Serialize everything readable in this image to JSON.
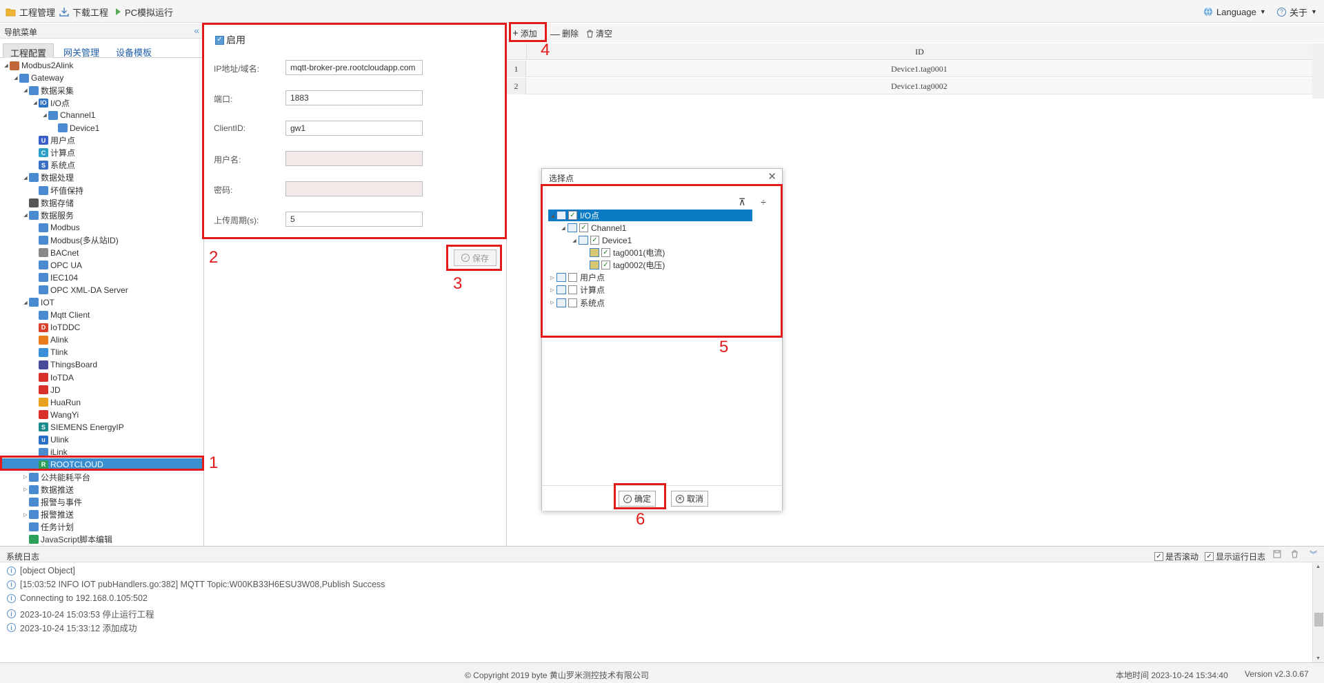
{
  "topbar": {
    "project_manage": "工程管理",
    "download_project": "下载工程",
    "pc_simulate": "PC模拟运行",
    "language": "Language",
    "about": "关于"
  },
  "nav": {
    "title": "导航菜单",
    "tabs": [
      "工程配置",
      "网关管理",
      "设备模板"
    ],
    "tree": [
      {
        "label": "Modbus2Alink",
        "indent": 0,
        "arrow": "◢",
        "icon": "stack-icon",
        "color": "#c0673a"
      },
      {
        "label": "Gateway",
        "indent": 1,
        "arrow": "◢",
        "icon": "gateway-icon",
        "color": "#4a8ad0"
      },
      {
        "label": "数据采集",
        "indent": 2,
        "arrow": "◢",
        "icon": "chart-icon",
        "color": "#4a8ad0"
      },
      {
        "label": "I/O点",
        "indent": 3,
        "arrow": "◢",
        "icon": "io-icon",
        "color": "#2f73c6"
      },
      {
        "label": "Channel1",
        "indent": 4,
        "arrow": "◢",
        "icon": "network-icon",
        "color": "#4a8ad0"
      },
      {
        "label": "Device1",
        "indent": 5,
        "arrow": "",
        "icon": "device-icon",
        "color": "#4a8ad0"
      },
      {
        "label": "用户点",
        "indent": 3,
        "arrow": "",
        "icon": "user-point-icon",
        "color": "#3b5fc9"
      },
      {
        "label": "计算点",
        "indent": 3,
        "arrow": "",
        "icon": "calc-point-icon",
        "color": "#2aa0c6"
      },
      {
        "label": "系统点",
        "indent": 3,
        "arrow": "",
        "icon": "system-point-icon",
        "color": "#3a6fc8"
      },
      {
        "label": "数据处理",
        "indent": 2,
        "arrow": "◢",
        "icon": "chart-line-icon",
        "color": "#4a8ad0"
      },
      {
        "label": "坏值保持",
        "indent": 3,
        "arrow": "",
        "icon": "wave-icon",
        "color": "#4a8ad0"
      },
      {
        "label": "数据存储",
        "indent": 2,
        "arrow": "",
        "icon": "database-icon",
        "color": "#555555"
      },
      {
        "label": "数据服务",
        "indent": 2,
        "arrow": "◢",
        "icon": "service-icon",
        "color": "#4a8ad0"
      },
      {
        "label": "Modbus",
        "indent": 3,
        "arrow": "",
        "icon": "modbus-icon",
        "color": "#4a8ad0"
      },
      {
        "label": "Modbus(多从站ID)",
        "indent": 3,
        "arrow": "",
        "icon": "modbus-icon",
        "color": "#4a8ad0"
      },
      {
        "label": "BACnet",
        "indent": 3,
        "arrow": "",
        "icon": "bacnet-icon",
        "color": "#888888"
      },
      {
        "label": "OPC UA",
        "indent": 3,
        "arrow": "",
        "icon": "opc-icon",
        "color": "#4a8ad0"
      },
      {
        "label": "IEC104",
        "indent": 3,
        "arrow": "",
        "icon": "iec-icon",
        "color": "#4a8ad0"
      },
      {
        "label": "OPC XML-DA Server",
        "indent": 3,
        "arrow": "",
        "icon": "opc-icon",
        "color": "#4a8ad0"
      },
      {
        "label": "IOT",
        "indent": 2,
        "arrow": "◢",
        "icon": "iot-icon",
        "color": "#4a8ad0"
      },
      {
        "label": "Mqtt Client",
        "indent": 3,
        "arrow": "",
        "icon": "mqtt-icon",
        "color": "#4a8ad0"
      },
      {
        "label": "IoTDDC",
        "indent": 3,
        "arrow": "",
        "icon": "iotddc-icon",
        "color": "#d8402a"
      },
      {
        "label": "Alink",
        "indent": 3,
        "arrow": "",
        "icon": "alink-icon",
        "color": "#e87b1e"
      },
      {
        "label": "Tlink",
        "indent": 3,
        "arrow": "",
        "icon": "tlink-icon",
        "color": "#3a8fd8"
      },
      {
        "label": "ThingsBoard",
        "indent": 3,
        "arrow": "",
        "icon": "thingsboard-icon",
        "color": "#4a4a9a"
      },
      {
        "label": "IoTDA",
        "indent": 3,
        "arrow": "",
        "icon": "huawei-icon",
        "color": "#d8302a"
      },
      {
        "label": "JD",
        "indent": 3,
        "arrow": "",
        "icon": "jd-icon",
        "color": "#d8302a"
      },
      {
        "label": "HuaRun",
        "indent": 3,
        "arrow": "",
        "icon": "huarun-icon",
        "color": "#e8a01e"
      },
      {
        "label": "WangYi",
        "indent": 3,
        "arrow": "",
        "icon": "wangyi-icon",
        "color": "#d8302a"
      },
      {
        "label": "SIEMENS EnergyIP",
        "indent": 3,
        "arrow": "",
        "icon": "siemens-icon",
        "color": "#1a8a8a"
      },
      {
        "label": "Ulink",
        "indent": 3,
        "arrow": "",
        "icon": "ulink-icon",
        "color": "#2a6fc6"
      },
      {
        "label": "iLink",
        "indent": 3,
        "arrow": "",
        "icon": "ilink-icon",
        "color": "#4a8ad0"
      },
      {
        "label": "ROOTCLOUD",
        "indent": 3,
        "arrow": "",
        "icon": "rootcloud-icon",
        "color": "#2aa05a",
        "selected": true
      },
      {
        "label": "公共能耗平台",
        "indent": 2,
        "arrow": "▷",
        "icon": "energy-icon",
        "color": "#4a8ad0"
      },
      {
        "label": "数据推送",
        "indent": 2,
        "arrow": "▷",
        "icon": "push-icon",
        "color": "#4a8ad0"
      },
      {
        "label": "报警与事件",
        "indent": 2,
        "arrow": "",
        "icon": "alarm-icon",
        "color": "#4a8ad0"
      },
      {
        "label": "报警推送",
        "indent": 2,
        "arrow": "▷",
        "icon": "alarm-push-icon",
        "color": "#4a8ad0"
      },
      {
        "label": "任务计划",
        "indent": 2,
        "arrow": "",
        "icon": "task-icon",
        "color": "#4a8ad0"
      },
      {
        "label": "JavaScript脚本编辑",
        "indent": 2,
        "arrow": "",
        "icon": "script-icon",
        "color": "#2aa05a"
      }
    ]
  },
  "form": {
    "enable_label": "启用",
    "ip_label": "IP地址/域名:",
    "ip_value": "mqtt-broker-pre.rootcloudapp.com",
    "port_label": "端口:",
    "port_value": "1883",
    "clientid_label": "ClientID:",
    "clientid_value": "gw1",
    "username_label": "用户名:",
    "username_value": "",
    "password_label": "密码:",
    "password_value": "",
    "upload_label": "上传周期(s):",
    "upload_value": "5",
    "save_label": "保存"
  },
  "grid": {
    "add_label": "添加",
    "delete_label": "删除",
    "clear_label": "清空",
    "col_id": "ID",
    "rows": [
      {
        "n": "1",
        "id": "Device1.tag0001"
      },
      {
        "n": "2",
        "id": "Device1.tag0002"
      }
    ]
  },
  "dialog": {
    "title": "选择点",
    "tree": [
      {
        "label": "I/O点",
        "arrow": "◢",
        "checked": true,
        "selected": true
      },
      {
        "label": "Channel1",
        "arrow": "◢",
        "checked": true
      },
      {
        "label": "Device1",
        "arrow": "◢",
        "checked": true
      },
      {
        "label": "tag0001(电流)",
        "arrow": "",
        "checked": true
      },
      {
        "label": "tag0002(电压)",
        "arrow": "",
        "checked": true
      },
      {
        "label": "用户点",
        "arrow": "▷",
        "checked": false
      },
      {
        "label": "计算点",
        "arrow": "▷",
        "checked": false
      },
      {
        "label": "系统点",
        "arrow": "▷",
        "checked": false
      }
    ],
    "confirm_label": "确定",
    "cancel_label": "取消"
  },
  "annotations": [
    "1",
    "2",
    "3",
    "4",
    "5",
    "6"
  ],
  "log": {
    "title": "系统日志",
    "auto_scroll": "是否滚动",
    "show_run_log": "显示运行日志",
    "lines": [
      "[object Object]",
      "[15:03:52 INFO IOT pubHandlers.go:382] MQTT Topic:W00KB33H6ESU3W08,Publish Success",
      "Connecting to 192.168.0.105:502",
      "2023-10-24 15:03:53 停止运行工程",
      "2023-10-24 15:33:12 添加成功"
    ]
  },
  "footer": {
    "copyright": "© Copyright 2019 byte 黄山罗米测控技术有限公司",
    "local_time": "本地时间 2023-10-24 15:34:40",
    "version": "Version v2.3.0.67"
  },
  "colors": {
    "annotation_red": "#e21a1a",
    "selected_blue": "#3a8fd0",
    "dialog_selected": "#0a7bc4"
  }
}
